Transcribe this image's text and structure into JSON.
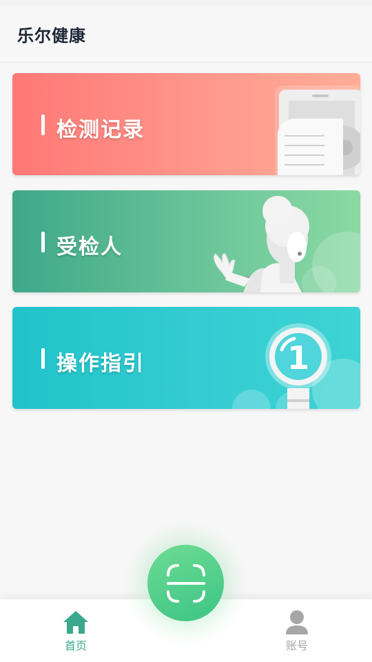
{
  "header": {
    "title": "乐尔健康"
  },
  "cards": [
    {
      "label": "检测记录",
      "icon": "document-record-icon"
    },
    {
      "label": "受检人",
      "icon": "person-waving-icon"
    },
    {
      "label": "操作指引",
      "icon": "magnifier-number-icon"
    }
  ],
  "guide_number": "1",
  "scan_button": {
    "icon": "scan-icon"
  },
  "tabbar": {
    "home_label": "首页",
    "account_label": "账号"
  },
  "colors": {
    "records_card": "#ff7f7b",
    "subjects_card": "#4caf8c",
    "guide_card": "#27c5cd",
    "scan_button": "#4fcc8a",
    "tab_active": "#3aa98d",
    "tab_inactive": "#a6a6a6"
  }
}
